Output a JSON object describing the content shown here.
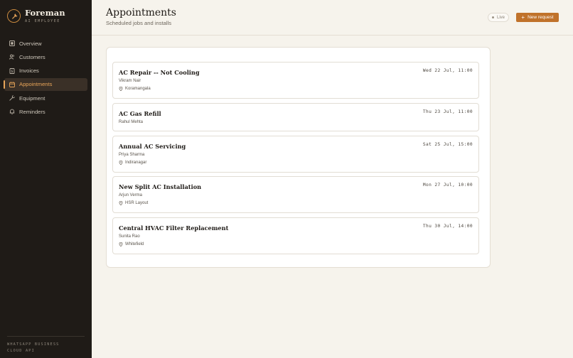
{
  "brand": {
    "name": "Foreman",
    "tagline": "AI EMPLOYEE"
  },
  "sidebar": {
    "items": [
      {
        "label": "Overview",
        "icon": "grid-icon",
        "active": false
      },
      {
        "label": "Customers",
        "icon": "users-icon",
        "active": false
      },
      {
        "label": "Invoices",
        "icon": "invoice-icon",
        "active": false
      },
      {
        "label": "Appointments",
        "icon": "calendar-icon",
        "active": true
      },
      {
        "label": "Equipment",
        "icon": "wrench-icon",
        "active": false
      },
      {
        "label": "Reminders",
        "icon": "bell-icon",
        "active": false
      }
    ],
    "footer_line1": "WHATSAPP BUSINESS",
    "footer_line2": "CLOUD API"
  },
  "header": {
    "title": "Appointments",
    "subtitle": "Scheduled jobs and installs",
    "live_label": "Live",
    "new_button_label": "New request"
  },
  "appointments": [
    {
      "title": "AC Repair -- Not Cooling",
      "customer": "Vikram Nair",
      "location": "Koramangala",
      "datetime": "Wed 22 Jul, 11:00"
    },
    {
      "title": "AC Gas Refill",
      "customer": "Rahul Mehta",
      "location": "",
      "datetime": "Thu 23 Jul, 11:00"
    },
    {
      "title": "Annual AC Servicing",
      "customer": "Priya Sharma",
      "location": "Indiranagar",
      "datetime": "Sat 25 Jul, 15:00"
    },
    {
      "title": "New Split AC Installation",
      "customer": "Arjun Verma",
      "location": "HSR Layout",
      "datetime": "Mon 27 Jul, 10:00"
    },
    {
      "title": "Central HVAC Filter Replacement",
      "customer": "Sunita Rao",
      "location": "Whitefield",
      "datetime": "Thu 30 Jul, 14:00"
    }
  ],
  "colors": {
    "accent": "#c0722b",
    "active_nav": "#e8a559",
    "sidebar_bg": "#1f1b17",
    "page_bg": "#f6f3ec"
  }
}
